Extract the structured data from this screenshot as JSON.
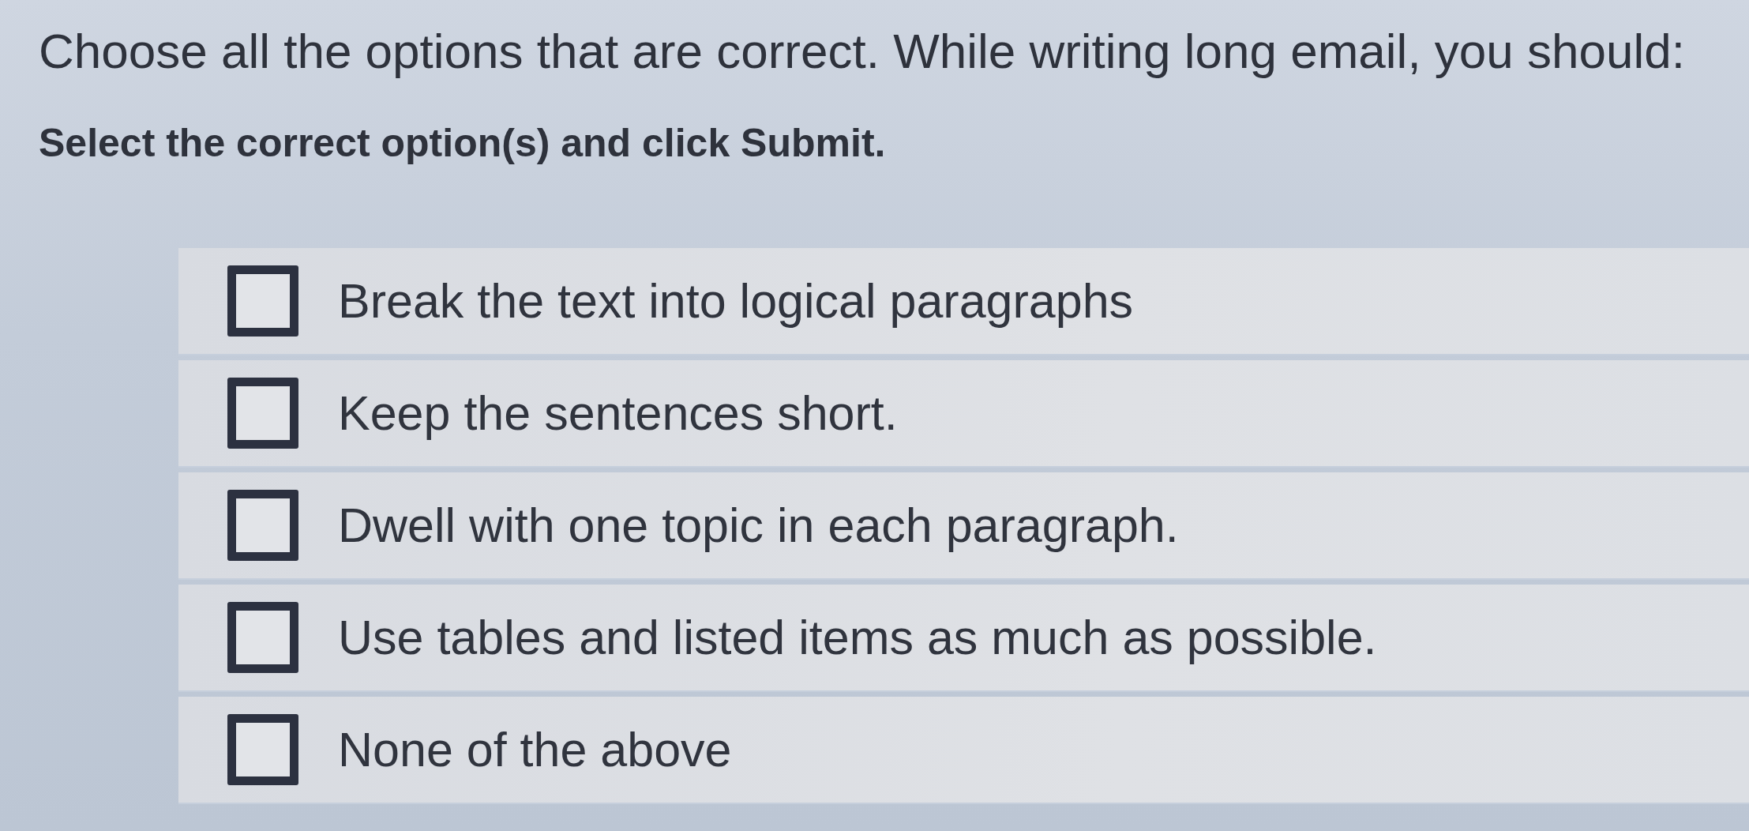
{
  "question": {
    "text": "Choose all the options that are correct. While writing long email, you should:",
    "instruction": "Select the correct option(s) and click Submit."
  },
  "options": [
    {
      "label": "Break the text into logical paragraphs",
      "checked": false
    },
    {
      "label": "Keep the sentences short.",
      "checked": false
    },
    {
      "label": "Dwell with one topic in each paragraph.",
      "checked": false
    },
    {
      "label": "Use tables and listed items as much as possible.",
      "checked": false
    },
    {
      "label": "None of the above",
      "checked": false
    }
  ]
}
